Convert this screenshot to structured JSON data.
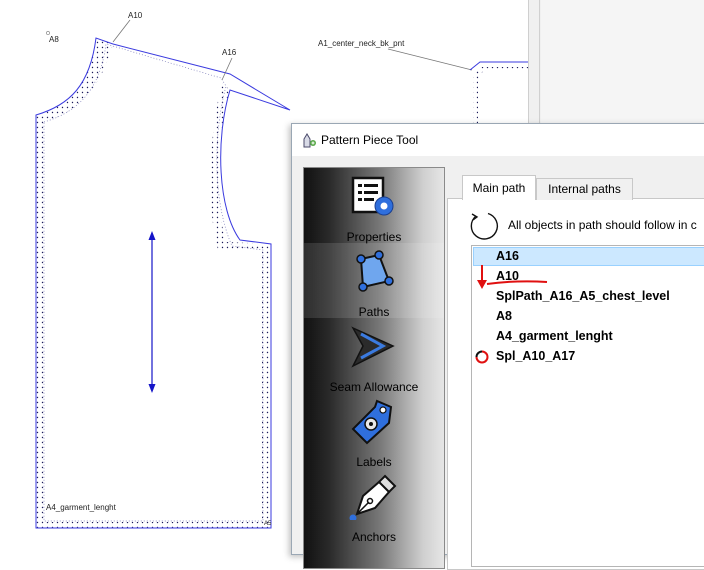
{
  "canvas": {
    "labels": {
      "a10": "A10",
      "a8": "A8",
      "a16": "A16",
      "center_neck": "A1_center_neck_bk_pnt",
      "garment": "A4_garment_lenght"
    }
  },
  "dialog": {
    "title": "Pattern Piece Tool",
    "sidebar": [
      {
        "label": "Properties",
        "icon": "properties-icon"
      },
      {
        "label": "Paths",
        "icon": "paths-icon"
      },
      {
        "label": "Seam Allowance",
        "icon": "seam-allowance-icon"
      },
      {
        "label": "Labels",
        "icon": "labels-icon"
      },
      {
        "label": "Anchors",
        "icon": "anchors-icon"
      }
    ],
    "tabs": {
      "main": "Main path",
      "internal": "Internal paths"
    },
    "follow_text": "All objects in path should follow in c",
    "path_items": [
      "A16",
      "A10",
      "SplPath_A16_A5_chest_level",
      "A8",
      "A4_garment_lenght",
      "Spl_A10_A17"
    ],
    "colors": {
      "selection": "#cce8ff",
      "pattern_line": "#3a3adf",
      "annotation_red": "#e01010"
    }
  }
}
